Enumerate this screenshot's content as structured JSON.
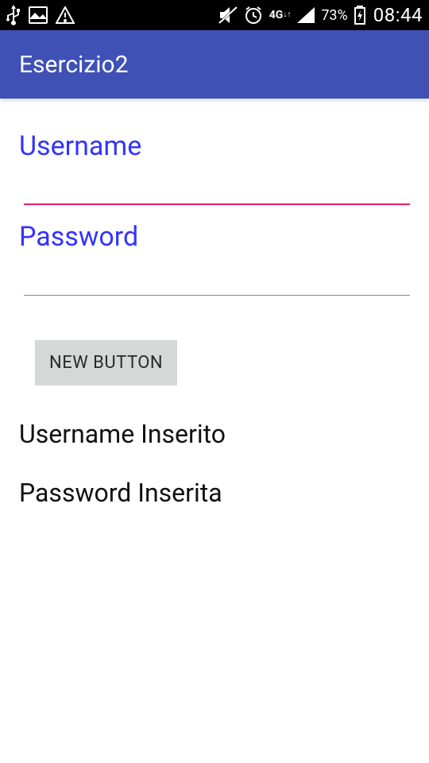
{
  "status": {
    "battery_percent": "73%",
    "time": "08:44"
  },
  "app_bar": {
    "title": "Esercizio2"
  },
  "form": {
    "username_label": "Username",
    "username_value": "",
    "password_label": "Password",
    "password_value": "",
    "button_label": "NEW BUTTON"
  },
  "output": {
    "username_result": "Username Inserito",
    "password_result": "Password Inserita"
  },
  "colors": {
    "primary": "#3F51B5",
    "accent": "#E91E63",
    "label": "#3333ff"
  }
}
